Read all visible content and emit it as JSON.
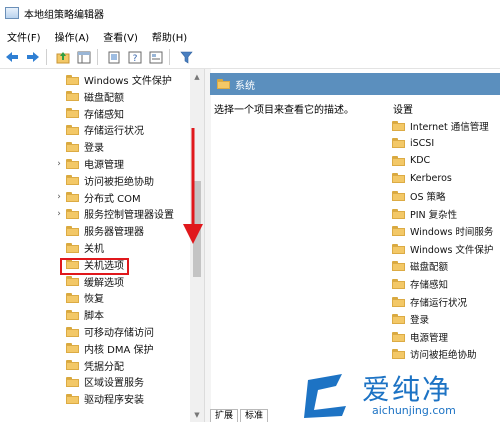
{
  "window": {
    "title": "本地组策略编辑器"
  },
  "menu": [
    "文件(F)",
    "操作(A)",
    "查看(V)",
    "帮助(H)"
  ],
  "toolbar": {
    "icons": [
      "back-arrow-icon",
      "forward-arrow-icon",
      "up-folder-icon",
      "show-tree-icon",
      "export-list-icon",
      "help-icon",
      "properties-icon",
      "filter-icon"
    ]
  },
  "tree": {
    "items": [
      {
        "label": "Windows 文件保护",
        "expandable": false
      },
      {
        "label": "磁盘配额",
        "expandable": false
      },
      {
        "label": "存储感知",
        "expandable": false
      },
      {
        "label": "存储运行状况",
        "expandable": false
      },
      {
        "label": "登录",
        "expandable": false
      },
      {
        "label": "电源管理",
        "expandable": true
      },
      {
        "label": "访问被拒绝协助",
        "expandable": false
      },
      {
        "label": "分布式 COM",
        "expandable": true
      },
      {
        "label": "服务控制管理器设置",
        "expandable": true
      },
      {
        "label": "服务器管理器",
        "expandable": false
      },
      {
        "label": "关机",
        "expandable": false
      },
      {
        "label": "关机选项",
        "expandable": false,
        "highlighted": true
      },
      {
        "label": "缓解选项",
        "expandable": false
      },
      {
        "label": "恢复",
        "expandable": false
      },
      {
        "label": "脚本",
        "expandable": false
      },
      {
        "label": "可移动存储访问",
        "expandable": false
      },
      {
        "label": "内核 DMA 保护",
        "expandable": false
      },
      {
        "label": "凭据分配",
        "expandable": false
      },
      {
        "label": "区域设置服务",
        "expandable": false
      },
      {
        "label": "驱动程序安装",
        "expandable": false
      }
    ]
  },
  "details": {
    "header_title": "系统",
    "description": "选择一个项目来查看它的描述。",
    "settings_header": "设置",
    "settings": [
      "Internet 通信管理",
      "iSCSI",
      "KDC",
      "Kerberos",
      "OS 策略",
      "PIN 复杂性",
      "Windows 时间服务",
      "Windows 文件保护",
      "磁盘配额",
      "存储感知",
      "存储运行状况",
      "登录",
      "电源管理",
      "访问被拒绝协助"
    ],
    "tabs": [
      "扩展",
      "标准"
    ]
  },
  "watermark": {
    "title": "爱纯净",
    "url": "aichunjing.com"
  },
  "colors": {
    "header_blue": "#5b8fbe",
    "folder_yellow": "#f3c867",
    "annotation_red": "#e0181c",
    "watermark_blue": "#1d73c4"
  }
}
